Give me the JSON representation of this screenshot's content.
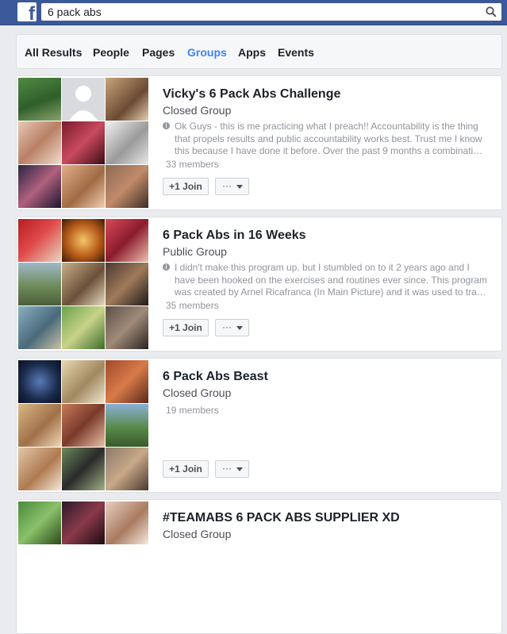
{
  "search": {
    "value": "6 pack abs"
  },
  "tabs": [
    {
      "label": "All Results"
    },
    {
      "label": "People"
    },
    {
      "label": "Pages"
    },
    {
      "label": "Groups"
    },
    {
      "label": "Apps"
    },
    {
      "label": "Events"
    }
  ],
  "active_tab": "Groups",
  "colors": {
    "header": "#3b5998",
    "active_tab": "#4080ff",
    "background": "#e9ebee"
  },
  "results": [
    {
      "title": "Vicky's 6 Pack Abs Challenge",
      "privacy": "Closed Group",
      "description": "Ok Guys - this is me practicing what I preach!! Accountability is the thing that propels results and public accountability works best. Trust me I know this because I have done it before. Over the past 9 months a combinati…",
      "members": "33 members",
      "join_label": "+1 Join",
      "more_label": "···"
    },
    {
      "title": "6 Pack Abs in 16 Weeks",
      "privacy": "Public Group",
      "description": "I didn't make this program up, but I stumbled on to it 2 years ago and I have been hooked on the exercises and routines ever since. This program was created by Arnel Ricafranca (In Main Picture) and it was used to tra…",
      "members": "35 members",
      "join_label": "+1 Join",
      "more_label": "···"
    },
    {
      "title": "6 Pack Abs Beast",
      "privacy": "Closed Group",
      "description": "",
      "members": "19 members",
      "join_label": "+1 Join",
      "more_label": "···"
    },
    {
      "title": "#TEAMABS 6 PACK ABS SUPPLIER XD",
      "privacy": "Closed Group"
    }
  ]
}
